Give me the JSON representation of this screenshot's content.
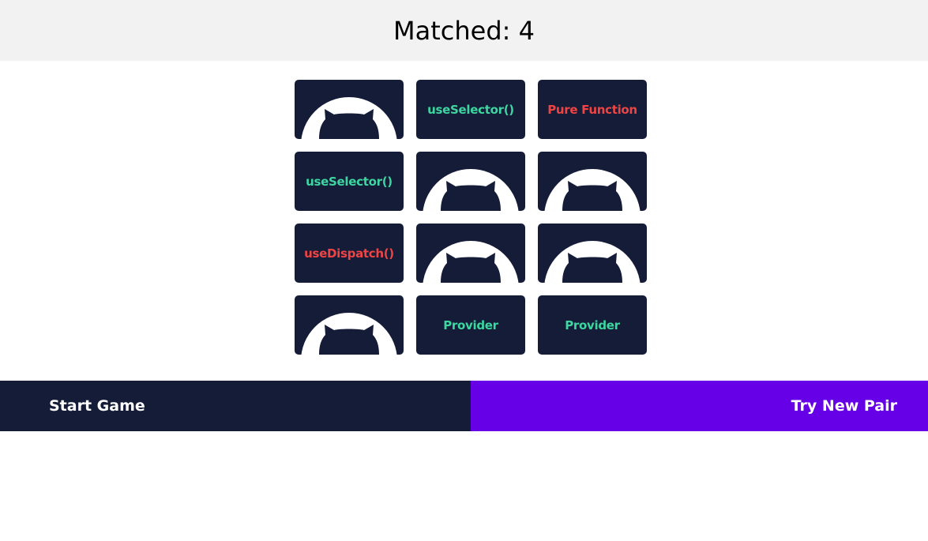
{
  "header": {
    "title": "Matched: 4"
  },
  "colors": {
    "card_bg": "#151c38",
    "card_front": "#ffffff",
    "matched_text": "#3dd6a0",
    "unmatched_text": "#f04444",
    "start_bg": "#151c38",
    "new_pair_bg": "#6600e6"
  },
  "cards": [
    {
      "state": "hidden",
      "icon": "cat-silhouette-icon",
      "label": ""
    },
    {
      "state": "matched",
      "label": "useSelector()"
    },
    {
      "state": "revealed",
      "label": "Pure Function"
    },
    {
      "state": "matched",
      "label": "useSelector()"
    },
    {
      "state": "hidden",
      "icon": "cat-silhouette-icon",
      "label": ""
    },
    {
      "state": "hidden",
      "icon": "cat-silhouette-icon",
      "label": ""
    },
    {
      "state": "revealed",
      "label": "useDispatch()"
    },
    {
      "state": "hidden",
      "icon": "cat-silhouette-icon",
      "label": ""
    },
    {
      "state": "hidden",
      "icon": "cat-silhouette-icon",
      "label": ""
    },
    {
      "state": "hidden",
      "icon": "cat-silhouette-icon",
      "label": ""
    },
    {
      "state": "matched",
      "label": "Provider"
    },
    {
      "state": "matched",
      "label": "Provider"
    }
  ],
  "footer": {
    "start_label": "Start Game",
    "new_pair_label": "Try New Pair"
  }
}
